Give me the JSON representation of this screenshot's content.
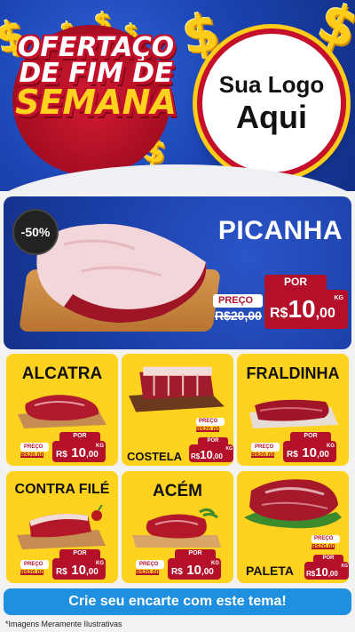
{
  "header": {
    "title_line1": "OFERTAÇO",
    "title_line2": "DE FIM DE",
    "title_line3": "SEMANA",
    "logo_line1": "Sua Logo",
    "logo_line2": "Aqui",
    "coin_symbol": "$"
  },
  "featured": {
    "discount": "-50%",
    "name": "PICANHA",
    "preco_label": "PREÇO",
    "old_price": "R$20,00",
    "por_label": "POR",
    "currency": "R$",
    "new_price_int": "10",
    "new_price_dec": ",00",
    "unit": "KG"
  },
  "products": [
    {
      "name": "ALCATRA",
      "preco_label": "PREÇO",
      "old_price": "R$20,00",
      "por_label": "POR",
      "currency": "R$",
      "new_price_int": "10",
      "new_price_dec": ",00",
      "unit": "KG"
    },
    {
      "name": "COSTELA",
      "preco_label": "PREÇO",
      "old_price": "R$20,00",
      "por_label": "POR",
      "currency": "R$",
      "new_price_int": "10",
      "new_price_dec": ",00",
      "unit": "KG"
    },
    {
      "name": "FRALDINHA",
      "preco_label": "PREÇO",
      "old_price": "R$20,00",
      "por_label": "POR",
      "currency": "R$",
      "new_price_int": "10",
      "new_price_dec": ",00",
      "unit": "KG"
    },
    {
      "name": "CONTRA FILÉ",
      "preco_label": "PREÇO",
      "old_price": "R$20,00",
      "por_label": "POR",
      "currency": "R$",
      "new_price_int": "10",
      "new_price_dec": ",00",
      "unit": "KG"
    },
    {
      "name": "ACÉM",
      "preco_label": "PREÇO",
      "old_price": "R$20,00",
      "por_label": "POR",
      "currency": "R$",
      "new_price_int": "10",
      "new_price_dec": ",00",
      "unit": "KG"
    },
    {
      "name": "PALETA",
      "preco_label": "PREÇO",
      "old_price": "R$20,00",
      "por_label": "POR",
      "currency": "R$",
      "new_price_int": "10",
      "new_price_dec": ",00",
      "unit": "KG"
    }
  ],
  "cta": {
    "label": "Crie seu encarte com este tema!"
  },
  "footnote": "*Imagens Meramente Ilustrativas",
  "colors": {
    "header_blue": "#1c45b3",
    "accent_red": "#b5102a",
    "card_yellow": "#ffd21f",
    "cta_blue": "#1f8fe0"
  }
}
